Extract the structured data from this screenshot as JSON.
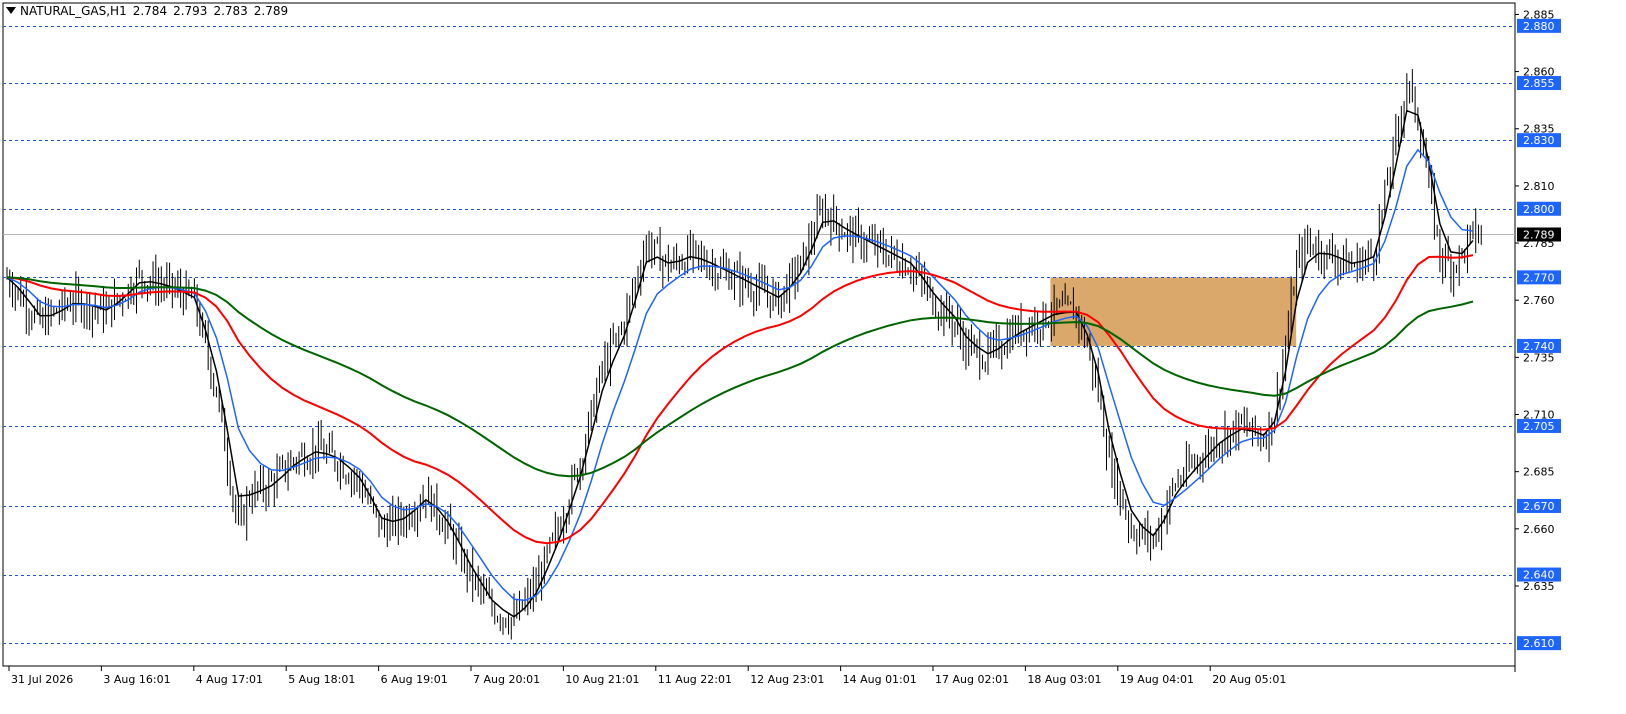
{
  "header": {
    "symbol_label": "NATURAL_GAS,H1",
    "open": "2.784",
    "high": "2.793",
    "low": "2.783",
    "close": "2.789"
  },
  "chart_data": {
    "type": "candlestick",
    "symbol": "NATURAL_GAS",
    "timeframe": "H1",
    "ylim": [
      2.6,
      2.89
    ],
    "y_ticks": [
      "2.885",
      "2.860",
      "2.835",
      "2.810",
      "2.785",
      "2.760",
      "2.735",
      "2.710",
      "2.685",
      "2.660",
      "2.635"
    ],
    "x_ticks": [
      "31 Jul 2026",
      "3 Aug 16:01",
      "4 Aug 17:01",
      "5 Aug 18:01",
      "6 Aug 19:01",
      "7 Aug 20:01",
      "10 Aug 21:01",
      "11 Aug 22:01",
      "12 Aug 23:01",
      "14 Aug 01:01",
      "17 Aug 02:01",
      "18 Aug 03:01",
      "19 Aug 04:01",
      "20 Aug 05:01"
    ],
    "horizontal_levels": [
      {
        "value": 2.88,
        "label": "2.880"
      },
      {
        "value": 2.855,
        "label": "2.855"
      },
      {
        "value": 2.83,
        "label": "2.830"
      },
      {
        "value": 2.8,
        "label": "2.800"
      },
      {
        "value": 2.77,
        "label": "2.770"
      },
      {
        "value": 2.74,
        "label": "2.740"
      },
      {
        "value": 2.705,
        "label": "2.705"
      },
      {
        "value": 2.67,
        "label": "2.670"
      },
      {
        "value": 2.64,
        "label": "2.640"
      },
      {
        "value": 2.61,
        "label": "2.610"
      }
    ],
    "current_price": {
      "value": 2.789,
      "label": "2.789"
    },
    "zone": {
      "from_x_tick": "18 Aug 03:01",
      "to_x_tick": "20 Aug 05:01",
      "y_low": 2.74,
      "y_high": 2.77,
      "color": "#d9a86a"
    },
    "price_path": [
      [
        0,
        2.77
      ],
      [
        3,
        2.75
      ],
      [
        6,
        2.76
      ],
      [
        9,
        2.755
      ],
      [
        12,
        2.77
      ],
      [
        15,
        2.765
      ],
      [
        17,
        2.76
      ],
      [
        19,
        2.72
      ],
      [
        20,
        2.69
      ],
      [
        21,
        2.66
      ],
      [
        22,
        2.675
      ],
      [
        24,
        2.68
      ],
      [
        26,
        2.69
      ],
      [
        28,
        2.695
      ],
      [
        30,
        2.69
      ],
      [
        32,
        2.68
      ],
      [
        34,
        2.66
      ],
      [
        36,
        2.665
      ],
      [
        38,
        2.675
      ],
      [
        40,
        2.66
      ],
      [
        42,
        2.64
      ],
      [
        44,
        2.625
      ],
      [
        46,
        2.62
      ],
      [
        48,
        2.635
      ],
      [
        50,
        2.66
      ],
      [
        52,
        2.69
      ],
      [
        54,
        2.73
      ],
      [
        56,
        2.75
      ],
      [
        58,
        2.785
      ],
      [
        60,
        2.775
      ],
      [
        62,
        2.78
      ],
      [
        64,
        2.775
      ],
      [
        66,
        2.77
      ],
      [
        68,
        2.765
      ],
      [
        70,
        2.76
      ],
      [
        72,
        2.775
      ],
      [
        74,
        2.8
      ],
      [
        76,
        2.79
      ],
      [
        78,
        2.785
      ],
      [
        80,
        2.78
      ],
      [
        82,
        2.775
      ],
      [
        84,
        2.76
      ],
      [
        86,
        2.75
      ],
      [
        87,
        2.74
      ],
      [
        89,
        2.735
      ],
      [
        91,
        2.745
      ],
      [
        93,
        2.75
      ],
      [
        95,
        2.755
      ],
      [
        97,
        2.755
      ],
      [
        98,
        2.74
      ],
      [
        99,
        2.72
      ],
      [
        100,
        2.69
      ],
      [
        102,
        2.66
      ],
      [
        104,
        2.655
      ],
      [
        106,
        2.68
      ],
      [
        108,
        2.69
      ],
      [
        110,
        2.7
      ],
      [
        112,
        2.705
      ],
      [
        114,
        2.7
      ],
      [
        115,
        2.71
      ],
      [
        116,
        2.74
      ],
      [
        117,
        2.775
      ],
      [
        118,
        2.785
      ],
      [
        120,
        2.78
      ],
      [
        122,
        2.775
      ],
      [
        124,
        2.78
      ],
      [
        126,
        2.83
      ],
      [
        127,
        2.855
      ],
      [
        128,
        2.84
      ],
      [
        129,
        2.81
      ],
      [
        130,
        2.78
      ],
      [
        131,
        2.775
      ],
      [
        132,
        2.78
      ],
      [
        133,
        2.789
      ]
    ],
    "series": [
      {
        "role": "close",
        "color": "#000000"
      },
      {
        "role": "fast_ma",
        "color": "#000000"
      },
      {
        "role": "medium_ma",
        "color": "#1e64ff"
      },
      {
        "role": "slow_ma",
        "color": "#ff0000"
      },
      {
        "role": "long_ma",
        "color": "#006400"
      }
    ],
    "colors": {
      "background": "#ffffff",
      "candles": "#000000",
      "grid_dash": "#1e50d2",
      "price_label_bg": "#1e64ff",
      "price_label_text": "#ffffff"
    }
  }
}
